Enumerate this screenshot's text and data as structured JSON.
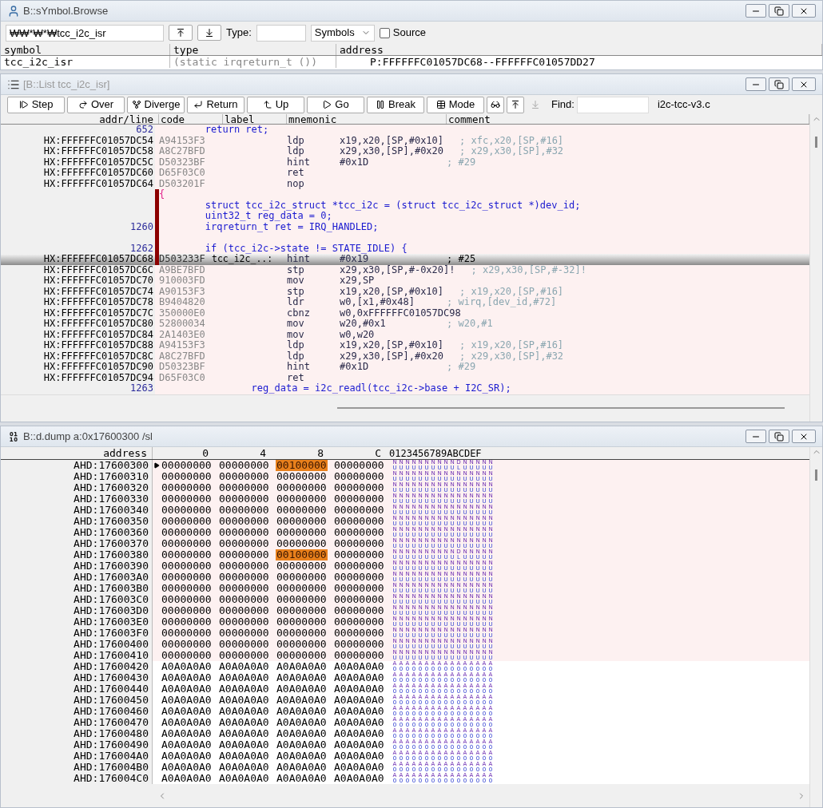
{
  "symbol_window": {
    "title": "B::sYmbol.Browse",
    "search": {
      "value": "₩₩*₩*₩tcc_i2c_isr"
    },
    "type_label": "Type:",
    "scope_select": {
      "value": "Symbols"
    },
    "source_checkbox": {
      "label": "Source",
      "checked": false
    },
    "columns": [
      "symbol",
      "type",
      "address"
    ],
    "rows": [
      {
        "symbol": "tcc_i2c_isr",
        "type": "(static irqreturn_t ())",
        "address": "P:FFFFFFC01057DC68--FFFFFFC01057DD27"
      }
    ]
  },
  "list_window": {
    "title": "[B::List tcc_i2c_isr]",
    "toolbar": [
      {
        "kind": "step",
        "label": "Step"
      },
      {
        "kind": "over",
        "label": "Over"
      },
      {
        "kind": "diverge",
        "label": "Diverge"
      },
      {
        "kind": "return",
        "label": "Return"
      },
      {
        "kind": "up",
        "label": "Up"
      },
      {
        "kind": "go",
        "label": "Go"
      },
      {
        "kind": "break",
        "label": "Break"
      },
      {
        "kind": "mode",
        "label": "Mode"
      }
    ],
    "icon_tools": [
      {
        "kind": "view",
        "disabled": false
      },
      {
        "kind": "up",
        "disabled": false
      },
      {
        "kind": "down",
        "disabled": true
      }
    ],
    "find_label": "Find:",
    "file": "i2c-tcc-v3.c",
    "columns": [
      "addr/line",
      "code",
      "label",
      "mnemonic",
      "comment"
    ],
    "rows": [
      {
        "kind": "source",
        "line": "652",
        "text": "        return ret;",
        "marked": false,
        "selected": false
      },
      {
        "kind": "asm",
        "address": "HX:FFFFFFC01057DC54",
        "code": "A94153F3",
        "mnemonic": "ldp",
        "operands": "x19,x20,[SP,#0x10]",
        "comment": "; xfc,x20,[SP,#16]",
        "marked": false,
        "selected": false
      },
      {
        "kind": "asm",
        "address": "HX:FFFFFFC01057DC58",
        "code": "A8C27BFD",
        "mnemonic": "ldp",
        "operands": "x29,x30,[SP],#0x20",
        "comment": "; x29,x30,[SP],#32",
        "marked": false,
        "selected": false
      },
      {
        "kind": "asm",
        "address": "HX:FFFFFFC01057DC5C",
        "code": "D50323BF",
        "mnemonic": "hint",
        "operands": "#0x1D",
        "comment": "; #29",
        "marked": false,
        "selected": false
      },
      {
        "kind": "asm",
        "address": "HX:FFFFFFC01057DC60",
        "code": "D65F03C0",
        "mnemonic": "ret",
        "marked": false,
        "selected": false
      },
      {
        "kind": "asm",
        "address": "HX:FFFFFFC01057DC64",
        "code": "D503201F",
        "mnemonic": "nop",
        "marked": false,
        "selected": false
      },
      {
        "kind": "source",
        "brace": "{",
        "marked": true,
        "selected": false
      },
      {
        "kind": "source",
        "text": "        struct tcc_i2c_struct *tcc_i2c = (struct tcc_i2c_struct *)dev_id;",
        "marked": true,
        "selected": false
      },
      {
        "kind": "source",
        "text": "        uint32_t reg_data = 0;",
        "marked": true,
        "selected": false
      },
      {
        "kind": "source",
        "line": "1260",
        "text": "        irqreturn_t ret = IRQ_HANDLED;",
        "marked": true,
        "selected": false
      },
      {
        "kind": "source",
        "marked": true,
        "selected": false
      },
      {
        "kind": "source",
        "line": "1262",
        "text": "        if (tcc_i2c->state != STATE_IDLE) {",
        "marked": true,
        "selected": false
      },
      {
        "kind": "asm",
        "address": "HX:FFFFFFC01057DC68",
        "code": "D503233F",
        "label": "tcc_i2c_..:",
        "mnemonic": "hint",
        "operands": "#0x19",
        "comment": "; #25",
        "marked": true,
        "selected": true
      },
      {
        "kind": "asm",
        "address": "HX:FFFFFFC01057DC6C",
        "code": "A9BE7BFD",
        "mnemonic": "stp",
        "operands": "x29,x30,[SP,#-0x20]!",
        "comment": "; x29,x30,[SP,#-32]!",
        "marked": false,
        "selected": false
      },
      {
        "kind": "asm",
        "address": "HX:FFFFFFC01057DC70",
        "code": "910003FD",
        "mnemonic": "mov",
        "operands": "x29,SP",
        "marked": false,
        "selected": false
      },
      {
        "kind": "asm",
        "address": "HX:FFFFFFC01057DC74",
        "code": "A90153F3",
        "mnemonic": "stp",
        "operands": "x19,x20,[SP,#0x10]",
        "comment": "; x19,x20,[SP,#16]",
        "marked": false,
        "selected": false
      },
      {
        "kind": "asm",
        "address": "HX:FFFFFFC01057DC78",
        "code": "B9404820",
        "mnemonic": "ldr",
        "operands": "w0,[x1,#0x48]",
        "comment": "; wirq,[dev_id,#72]",
        "marked": false,
        "selected": false
      },
      {
        "kind": "asm",
        "address": "HX:FFFFFFC01057DC7C",
        "code": "350000E0",
        "mnemonic": "cbnz",
        "operands": "w0,0xFFFFFFC01057DC98",
        "marked": false,
        "selected": false
      },
      {
        "kind": "asm",
        "address": "HX:FFFFFFC01057DC80",
        "code": "52800034",
        "mnemonic": "mov",
        "operands": "w20,#0x1",
        "comment": "; w20,#1",
        "marked": false,
        "selected": false
      },
      {
        "kind": "asm",
        "address": "HX:FFFFFFC01057DC84",
        "code": "2A1403E0",
        "mnemonic": "mov",
        "operands": "w0,w20",
        "marked": false,
        "selected": false
      },
      {
        "kind": "asm",
        "address": "HX:FFFFFFC01057DC88",
        "code": "A94153F3",
        "mnemonic": "ldp",
        "operands": "x19,x20,[SP,#0x10]",
        "comment": "; x19,x20,[SP,#16]",
        "marked": false,
        "selected": false
      },
      {
        "kind": "asm",
        "address": "HX:FFFFFFC01057DC8C",
        "code": "A8C27BFD",
        "mnemonic": "ldp",
        "operands": "x29,x30,[SP],#0x20",
        "comment": "; x29,x30,[SP],#32",
        "marked": false,
        "selected": false
      },
      {
        "kind": "asm",
        "address": "HX:FFFFFFC01057DC90",
        "code": "D50323BF",
        "mnemonic": "hint",
        "operands": "#0x1D",
        "comment": "; #29",
        "marked": false,
        "selected": false
      },
      {
        "kind": "asm",
        "address": "HX:FFFFFFC01057DC94",
        "code": "D65F03C0",
        "mnemonic": "ret",
        "marked": false,
        "selected": false
      },
      {
        "kind": "source",
        "line": "1263",
        "text": "                reg_data = i2c_readl(tcc_i2c->base + I2C_SR);",
        "marked": false,
        "selected": false
      }
    ]
  },
  "dump_window": {
    "title": "B::d.dump a:0x17600300 /sl",
    "columns": [
      "address",
      "0",
      "4",
      "8",
      "C",
      "0123456789ABCDEF"
    ],
    "rows": [
      {
        "address": "AHD:17600300",
        "current": true,
        "tinted": true,
        "words": [
          {
            "value": "00000000",
            "changed": false
          },
          {
            "value": "00000000",
            "changed": false
          },
          {
            "value": "00100000",
            "changed": true
          },
          {
            "value": "00000000",
            "changed": false
          }
        ],
        "ascii": [
          "NU",
          "NU",
          "NU",
          "NU",
          "NU",
          "NU",
          "NU",
          "NU",
          "NU",
          "NU",
          "DL",
          "NU",
          "NU",
          "NU",
          "NU",
          "NU"
        ]
      },
      {
        "address": "AHD:17600310",
        "current": false,
        "tinted": true,
        "words": [
          {
            "value": "00000000",
            "changed": false
          },
          {
            "value": "00000000",
            "changed": false
          },
          {
            "value": "00000000",
            "changed": false
          },
          {
            "value": "00000000",
            "changed": false
          }
        ],
        "ascii": [
          "NU",
          "NU",
          "NU",
          "NU",
          "NU",
          "NU",
          "NU",
          "NU",
          "NU",
          "NU",
          "NU",
          "NU",
          "NU",
          "NU",
          "NU",
          "NU"
        ]
      },
      {
        "address": "AHD:17600320",
        "current": false,
        "tinted": true,
        "words": [
          {
            "value": "00000000",
            "changed": false
          },
          {
            "value": "00000000",
            "changed": false
          },
          {
            "value": "00000000",
            "changed": false
          },
          {
            "value": "00000000",
            "changed": false
          }
        ],
        "ascii": [
          "NU",
          "NU",
          "NU",
          "NU",
          "NU",
          "NU",
          "NU",
          "NU",
          "NU",
          "NU",
          "NU",
          "NU",
          "NU",
          "NU",
          "NU",
          "NU"
        ]
      },
      {
        "address": "AHD:17600330",
        "current": false,
        "tinted": true,
        "words": [
          {
            "value": "00000000",
            "changed": false
          },
          {
            "value": "00000000",
            "changed": false
          },
          {
            "value": "00000000",
            "changed": false
          },
          {
            "value": "00000000",
            "changed": false
          }
        ],
        "ascii": [
          "NU",
          "NU",
          "NU",
          "NU",
          "NU",
          "NU",
          "NU",
          "NU",
          "NU",
          "NU",
          "NU",
          "NU",
          "NU",
          "NU",
          "NU",
          "NU"
        ]
      },
      {
        "address": "AHD:17600340",
        "current": false,
        "tinted": true,
        "words": [
          {
            "value": "00000000",
            "changed": false
          },
          {
            "value": "00000000",
            "changed": false
          },
          {
            "value": "00000000",
            "changed": false
          },
          {
            "value": "00000000",
            "changed": false
          }
        ],
        "ascii": [
          "NU",
          "NU",
          "NU",
          "NU",
          "NU",
          "NU",
          "NU",
          "NU",
          "NU",
          "NU",
          "NU",
          "NU",
          "NU",
          "NU",
          "NU",
          "NU"
        ]
      },
      {
        "address": "AHD:17600350",
        "current": false,
        "tinted": true,
        "words": [
          {
            "value": "00000000",
            "changed": false
          },
          {
            "value": "00000000",
            "changed": false
          },
          {
            "value": "00000000",
            "changed": false
          },
          {
            "value": "00000000",
            "changed": false
          }
        ],
        "ascii": [
          "NU",
          "NU",
          "NU",
          "NU",
          "NU",
          "NU",
          "NU",
          "NU",
          "NU",
          "NU",
          "NU",
          "NU",
          "NU",
          "NU",
          "NU",
          "NU"
        ]
      },
      {
        "address": "AHD:17600360",
        "current": false,
        "tinted": true,
        "words": [
          {
            "value": "00000000",
            "changed": false
          },
          {
            "value": "00000000",
            "changed": false
          },
          {
            "value": "00000000",
            "changed": false
          },
          {
            "value": "00000000",
            "changed": false
          }
        ],
        "ascii": [
          "NU",
          "NU",
          "NU",
          "NU",
          "NU",
          "NU",
          "NU",
          "NU",
          "NU",
          "NU",
          "NU",
          "NU",
          "NU",
          "NU",
          "NU",
          "NU"
        ]
      },
      {
        "address": "AHD:17600370",
        "current": false,
        "tinted": true,
        "words": [
          {
            "value": "00000000",
            "changed": false
          },
          {
            "value": "00000000",
            "changed": false
          },
          {
            "value": "00000000",
            "changed": false
          },
          {
            "value": "00000000",
            "changed": false
          }
        ],
        "ascii": [
          "NU",
          "NU",
          "NU",
          "NU",
          "NU",
          "NU",
          "NU",
          "NU",
          "NU",
          "NU",
          "NU",
          "NU",
          "NU",
          "NU",
          "NU",
          "NU"
        ]
      },
      {
        "address": "AHD:17600380",
        "current": false,
        "tinted": true,
        "words": [
          {
            "value": "00000000",
            "changed": false
          },
          {
            "value": "00000000",
            "changed": false
          },
          {
            "value": "00100000",
            "changed": true
          },
          {
            "value": "00000000",
            "changed": false
          }
        ],
        "ascii": [
          "NU",
          "NU",
          "NU",
          "NU",
          "NU",
          "NU",
          "NU",
          "NU",
          "NU",
          "NU",
          "DL",
          "NU",
          "NU",
          "NU",
          "NU",
          "NU"
        ]
      },
      {
        "address": "AHD:17600390",
        "current": false,
        "tinted": true,
        "words": [
          {
            "value": "00000000",
            "changed": false
          },
          {
            "value": "00000000",
            "changed": false
          },
          {
            "value": "00000000",
            "changed": false
          },
          {
            "value": "00000000",
            "changed": false
          }
        ],
        "ascii": [
          "NU",
          "NU",
          "NU",
          "NU",
          "NU",
          "NU",
          "NU",
          "NU",
          "NU",
          "NU",
          "NU",
          "NU",
          "NU",
          "NU",
          "NU",
          "NU"
        ]
      },
      {
        "address": "AHD:176003A0",
        "current": false,
        "tinted": true,
        "words": [
          {
            "value": "00000000",
            "changed": false
          },
          {
            "value": "00000000",
            "changed": false
          },
          {
            "value": "00000000",
            "changed": false
          },
          {
            "value": "00000000",
            "changed": false
          }
        ],
        "ascii": [
          "NU",
          "NU",
          "NU",
          "NU",
          "NU",
          "NU",
          "NU",
          "NU",
          "NU",
          "NU",
          "NU",
          "NU",
          "NU",
          "NU",
          "NU",
          "NU"
        ]
      },
      {
        "address": "AHD:176003B0",
        "current": false,
        "tinted": true,
        "words": [
          {
            "value": "00000000",
            "changed": false
          },
          {
            "value": "00000000",
            "changed": false
          },
          {
            "value": "00000000",
            "changed": false
          },
          {
            "value": "00000000",
            "changed": false
          }
        ],
        "ascii": [
          "NU",
          "NU",
          "NU",
          "NU",
          "NU",
          "NU",
          "NU",
          "NU",
          "NU",
          "NU",
          "NU",
          "NU",
          "NU",
          "NU",
          "NU",
          "NU"
        ]
      },
      {
        "address": "AHD:176003C0",
        "current": false,
        "tinted": true,
        "words": [
          {
            "value": "00000000",
            "changed": false
          },
          {
            "value": "00000000",
            "changed": false
          },
          {
            "value": "00000000",
            "changed": false
          },
          {
            "value": "00000000",
            "changed": false
          }
        ],
        "ascii": [
          "NU",
          "NU",
          "NU",
          "NU",
          "NU",
          "NU",
          "NU",
          "NU",
          "NU",
          "NU",
          "NU",
          "NU",
          "NU",
          "NU",
          "NU",
          "NU"
        ]
      },
      {
        "address": "AHD:176003D0",
        "current": false,
        "tinted": true,
        "words": [
          {
            "value": "00000000",
            "changed": false
          },
          {
            "value": "00000000",
            "changed": false
          },
          {
            "value": "00000000",
            "changed": false
          },
          {
            "value": "00000000",
            "changed": false
          }
        ],
        "ascii": [
          "NU",
          "NU",
          "NU",
          "NU",
          "NU",
          "NU",
          "NU",
          "NU",
          "NU",
          "NU",
          "NU",
          "NU",
          "NU",
          "NU",
          "NU",
          "NU"
        ]
      },
      {
        "address": "AHD:176003E0",
        "current": false,
        "tinted": true,
        "words": [
          {
            "value": "00000000",
            "changed": false
          },
          {
            "value": "00000000",
            "changed": false
          },
          {
            "value": "00000000",
            "changed": false
          },
          {
            "value": "00000000",
            "changed": false
          }
        ],
        "ascii": [
          "NU",
          "NU",
          "NU",
          "NU",
          "NU",
          "NU",
          "NU",
          "NU",
          "NU",
          "NU",
          "NU",
          "NU",
          "NU",
          "NU",
          "NU",
          "NU"
        ]
      },
      {
        "address": "AHD:176003F0",
        "current": false,
        "tinted": true,
        "words": [
          {
            "value": "00000000",
            "changed": false
          },
          {
            "value": "00000000",
            "changed": false
          },
          {
            "value": "00000000",
            "changed": false
          },
          {
            "value": "00000000",
            "changed": false
          }
        ],
        "ascii": [
          "NU",
          "NU",
          "NU",
          "NU",
          "NU",
          "NU",
          "NU",
          "NU",
          "NU",
          "NU",
          "NU",
          "NU",
          "NU",
          "NU",
          "NU",
          "NU"
        ]
      },
      {
        "address": "AHD:17600400",
        "current": false,
        "tinted": true,
        "words": [
          {
            "value": "00000000",
            "changed": false
          },
          {
            "value": "00000000",
            "changed": false
          },
          {
            "value": "00000000",
            "changed": false
          },
          {
            "value": "00000000",
            "changed": false
          }
        ],
        "ascii": [
          "NU",
          "NU",
          "NU",
          "NU",
          "NU",
          "NU",
          "NU",
          "NU",
          "NU",
          "NU",
          "NU",
          "NU",
          "NU",
          "NU",
          "NU",
          "NU"
        ]
      },
      {
        "address": "AHD:17600410",
        "current": false,
        "tinted": true,
        "words": [
          {
            "value": "00000000",
            "changed": false
          },
          {
            "value": "00000000",
            "changed": false
          },
          {
            "value": "00000000",
            "changed": false
          },
          {
            "value": "00000000",
            "changed": false
          }
        ],
        "ascii": [
          "NU",
          "NU",
          "NU",
          "NU",
          "NU",
          "NU",
          "NU",
          "NU",
          "NU",
          "NU",
          "NU",
          "NU",
          "NU",
          "NU",
          "NU",
          "NU"
        ]
      },
      {
        "address": "AHD:17600420",
        "current": false,
        "tinted": false,
        "words": [
          {
            "value": "A0A0A0A0",
            "changed": false
          },
          {
            "value": "A0A0A0A0",
            "changed": false
          },
          {
            "value": "A0A0A0A0",
            "changed": false
          },
          {
            "value": "A0A0A0A0",
            "changed": false
          }
        ],
        "ascii": [
          "A0",
          "A0",
          "A0",
          "A0",
          "A0",
          "A0",
          "A0",
          "A0",
          "A0",
          "A0",
          "A0",
          "A0",
          "A0",
          "A0",
          "A0",
          "A0"
        ]
      },
      {
        "address": "AHD:17600430",
        "current": false,
        "tinted": false,
        "words": [
          {
            "value": "A0A0A0A0",
            "changed": false
          },
          {
            "value": "A0A0A0A0",
            "changed": false
          },
          {
            "value": "A0A0A0A0",
            "changed": false
          },
          {
            "value": "A0A0A0A0",
            "changed": false
          }
        ],
        "ascii": [
          "A0",
          "A0",
          "A0",
          "A0",
          "A0",
          "A0",
          "A0",
          "A0",
          "A0",
          "A0",
          "A0",
          "A0",
          "A0",
          "A0",
          "A0",
          "A0"
        ]
      },
      {
        "address": "AHD:17600440",
        "current": false,
        "tinted": false,
        "words": [
          {
            "value": "A0A0A0A0",
            "changed": false
          },
          {
            "value": "A0A0A0A0",
            "changed": false
          },
          {
            "value": "A0A0A0A0",
            "changed": false
          },
          {
            "value": "A0A0A0A0",
            "changed": false
          }
        ],
        "ascii": [
          "A0",
          "A0",
          "A0",
          "A0",
          "A0",
          "A0",
          "A0",
          "A0",
          "A0",
          "A0",
          "A0",
          "A0",
          "A0",
          "A0",
          "A0",
          "A0"
        ]
      },
      {
        "address": "AHD:17600450",
        "current": false,
        "tinted": false,
        "words": [
          {
            "value": "A0A0A0A0",
            "changed": false
          },
          {
            "value": "A0A0A0A0",
            "changed": false
          },
          {
            "value": "A0A0A0A0",
            "changed": false
          },
          {
            "value": "A0A0A0A0",
            "changed": false
          }
        ],
        "ascii": [
          "A0",
          "A0",
          "A0",
          "A0",
          "A0",
          "A0",
          "A0",
          "A0",
          "A0",
          "A0",
          "A0",
          "A0",
          "A0",
          "A0",
          "A0",
          "A0"
        ]
      },
      {
        "address": "AHD:17600460",
        "current": false,
        "tinted": false,
        "words": [
          {
            "value": "A0A0A0A0",
            "changed": false
          },
          {
            "value": "A0A0A0A0",
            "changed": false
          },
          {
            "value": "A0A0A0A0",
            "changed": false
          },
          {
            "value": "A0A0A0A0",
            "changed": false
          }
        ],
        "ascii": [
          "A0",
          "A0",
          "A0",
          "A0",
          "A0",
          "A0",
          "A0",
          "A0",
          "A0",
          "A0",
          "A0",
          "A0",
          "A0",
          "A0",
          "A0",
          "A0"
        ]
      },
      {
        "address": "AHD:17600470",
        "current": false,
        "tinted": false,
        "words": [
          {
            "value": "A0A0A0A0",
            "changed": false
          },
          {
            "value": "A0A0A0A0",
            "changed": false
          },
          {
            "value": "A0A0A0A0",
            "changed": false
          },
          {
            "value": "A0A0A0A0",
            "changed": false
          }
        ],
        "ascii": [
          "A0",
          "A0",
          "A0",
          "A0",
          "A0",
          "A0",
          "A0",
          "A0",
          "A0",
          "A0",
          "A0",
          "A0",
          "A0",
          "A0",
          "A0",
          "A0"
        ]
      },
      {
        "address": "AHD:17600480",
        "current": false,
        "tinted": false,
        "words": [
          {
            "value": "A0A0A0A0",
            "changed": false
          },
          {
            "value": "A0A0A0A0",
            "changed": false
          },
          {
            "value": "A0A0A0A0",
            "changed": false
          },
          {
            "value": "A0A0A0A0",
            "changed": false
          }
        ],
        "ascii": [
          "A0",
          "A0",
          "A0",
          "A0",
          "A0",
          "A0",
          "A0",
          "A0",
          "A0",
          "A0",
          "A0",
          "A0",
          "A0",
          "A0",
          "A0",
          "A0"
        ]
      },
      {
        "address": "AHD:17600490",
        "current": false,
        "tinted": false,
        "words": [
          {
            "value": "A0A0A0A0",
            "changed": false
          },
          {
            "value": "A0A0A0A0",
            "changed": false
          },
          {
            "value": "A0A0A0A0",
            "changed": false
          },
          {
            "value": "A0A0A0A0",
            "changed": false
          }
        ],
        "ascii": [
          "A0",
          "A0",
          "A0",
          "A0",
          "A0",
          "A0",
          "A0",
          "A0",
          "A0",
          "A0",
          "A0",
          "A0",
          "A0",
          "A0",
          "A0",
          "A0"
        ]
      },
      {
        "address": "AHD:176004A0",
        "current": false,
        "tinted": false,
        "words": [
          {
            "value": "A0A0A0A0",
            "changed": false
          },
          {
            "value": "A0A0A0A0",
            "changed": false
          },
          {
            "value": "A0A0A0A0",
            "changed": false
          },
          {
            "value": "A0A0A0A0",
            "changed": false
          }
        ],
        "ascii": [
          "A0",
          "A0",
          "A0",
          "A0",
          "A0",
          "A0",
          "A0",
          "A0",
          "A0",
          "A0",
          "A0",
          "A0",
          "A0",
          "A0",
          "A0",
          "A0"
        ]
      },
      {
        "address": "AHD:176004B0",
        "current": false,
        "tinted": false,
        "words": [
          {
            "value": "A0A0A0A0",
            "changed": false
          },
          {
            "value": "A0A0A0A0",
            "changed": false
          },
          {
            "value": "A0A0A0A0",
            "changed": false
          },
          {
            "value": "A0A0A0A0",
            "changed": false
          }
        ],
        "ascii": [
          "A0",
          "A0",
          "A0",
          "A0",
          "A0",
          "A0",
          "A0",
          "A0",
          "A0",
          "A0",
          "A0",
          "A0",
          "A0",
          "A0",
          "A0",
          "A0"
        ]
      },
      {
        "address": "AHD:176004C0",
        "current": false,
        "tinted": false,
        "words": [
          {
            "value": "A0A0A0A0",
            "changed": false
          },
          {
            "value": "A0A0A0A0",
            "changed": false
          },
          {
            "value": "A0A0A0A0",
            "changed": false
          },
          {
            "value": "A0A0A0A0",
            "changed": false
          }
        ],
        "ascii": [
          "A0",
          "A0",
          "A0",
          "A0",
          "A0",
          "A0",
          "A0",
          "A0",
          "A0",
          "A0",
          "A0",
          "A0",
          "A0",
          "A0",
          "A0",
          "A0"
        ]
      }
    ]
  }
}
